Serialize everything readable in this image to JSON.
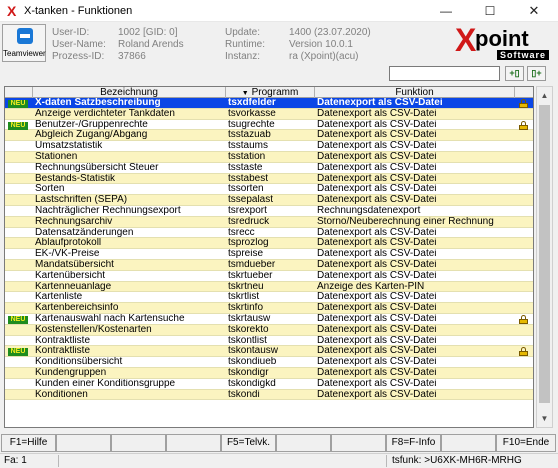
{
  "window": {
    "title": "X-tanken - Funktionen",
    "icon": "x-app-icon",
    "minimize": "—",
    "maximize": "☐",
    "close": "✕"
  },
  "teamviewer": {
    "label": "Teamviewer"
  },
  "info": {
    "labels1": "User-ID:\nUser-Name:\nProzess-ID:",
    "values1": "1002 [GID: 0]\nRoland Arends\n37866",
    "labels2": "Update:\nRuntime:\nInstanz:",
    "values2": "1400 (23.07.2020)\nVersion 10.0.1\nra (Xpoint)(acu)"
  },
  "logo": {
    "x": "X",
    "word": "point",
    "sub": "Software"
  },
  "toolbar": {
    "search_value": "",
    "btn1": "+▯",
    "btn2": "▯+"
  },
  "grid": {
    "headers": [
      "",
      "Bezeichnung",
      "Programm",
      "Funktion",
      ""
    ],
    "sort_indicator": "▼",
    "new_badge": "NEU",
    "rows": [
      {
        "new": true,
        "name": "X-daten Satzbeschreibung",
        "prog": "tsxdfelder",
        "func": "Datenexport als CSV-Datei",
        "lock": true,
        "selected": true
      },
      {
        "new": false,
        "name": "Anzeige verdichteter Tankdaten",
        "prog": "tsvorkasse",
        "func": "Datenexport als CSV-Datei",
        "lock": false
      },
      {
        "new": true,
        "name": "Benutzer-/Gruppenrechte",
        "prog": "tsugrechte",
        "func": "Datenexport als CSV-Datei",
        "lock": true
      },
      {
        "new": false,
        "name": "Abgleich Zugang/Abgang",
        "prog": "tsstazuab",
        "func": "Datenexport als CSV-Datei",
        "lock": false
      },
      {
        "new": false,
        "name": "Umsatzstatistik",
        "prog": "tsstaums",
        "func": "Datenexport als CSV-Datei",
        "lock": false
      },
      {
        "new": false,
        "name": "Stationen",
        "prog": "tsstation",
        "func": "Datenexport als CSV-Datei",
        "lock": false
      },
      {
        "new": false,
        "name": "Rechnungsübersicht Steuer",
        "prog": "tsstaste",
        "func": "Datenexport als CSV-Datei",
        "lock": false
      },
      {
        "new": false,
        "name": "Bestands-Statistik",
        "prog": "tsstabest",
        "func": "Datenexport als CSV-Datei",
        "lock": false
      },
      {
        "new": false,
        "name": "Sorten",
        "prog": "tssorten",
        "func": "Datenexport als CSV-Datei",
        "lock": false
      },
      {
        "new": false,
        "name": "Lastschriften (SEPA)",
        "prog": "tssepalast",
        "func": "Datenexport als CSV-Datei",
        "lock": false
      },
      {
        "new": false,
        "name": "Nachträglicher Rechnungsexport",
        "prog": "tsrexport",
        "func": "Rechnungsdatenexport",
        "lock": false
      },
      {
        "new": false,
        "name": "Rechnungsarchiv",
        "prog": "tsredruck",
        "func": "Storno/Neuberechnung einer Rechnung",
        "lock": false
      },
      {
        "new": false,
        "name": "Datensatzänderungen",
        "prog": "tsrecc",
        "func": "Datenexport als CSV-Datei",
        "lock": false
      },
      {
        "new": false,
        "name": "Ablaufprotokoll",
        "prog": "tsprozlog",
        "func": "Datenexport als CSV-Datei",
        "lock": false
      },
      {
        "new": false,
        "name": "EK-/VK-Preise",
        "prog": "tspreise",
        "func": "Datenexport als CSV-Datei",
        "lock": false
      },
      {
        "new": false,
        "name": "Mandatsübersicht",
        "prog": "tsmdueber",
        "func": "Datenexport als CSV-Datei",
        "lock": false
      },
      {
        "new": false,
        "name": "Kartenübersicht",
        "prog": "tskrtueber",
        "func": "Datenexport als CSV-Datei",
        "lock": false
      },
      {
        "new": false,
        "name": "Kartenneuanlage",
        "prog": "tskrtneu",
        "func": "Anzeige des Karten-PIN",
        "lock": false
      },
      {
        "new": false,
        "name": "Kartenliste",
        "prog": "tskrtlist",
        "func": "Datenexport als CSV-Datei",
        "lock": false
      },
      {
        "new": false,
        "name": "Kartenbereichsinfo",
        "prog": "tskrtinfo",
        "func": "Datenexport als CSV-Datei",
        "lock": false
      },
      {
        "new": true,
        "name": "Kartenauswahl nach Kartensuche",
        "prog": "tskrtausw",
        "func": "Datenexport als CSV-Datei",
        "lock": true
      },
      {
        "new": false,
        "name": "Kostenstellen/Kostenarten",
        "prog": "tskorekto",
        "func": "Datenexport als CSV-Datei",
        "lock": false
      },
      {
        "new": false,
        "name": "Kontraktliste",
        "prog": "tskontlist",
        "func": "Datenexport als CSV-Datei",
        "lock": false
      },
      {
        "new": true,
        "name": "Kontraktliste",
        "prog": "tskontausw",
        "func": "Datenexport als CSV-Datei",
        "lock": true
      },
      {
        "new": false,
        "name": "Konditionsübersicht",
        "prog": "tskondiueb",
        "func": "Datenexport als CSV-Datei",
        "lock": false
      },
      {
        "new": false,
        "name": "Kundengruppen",
        "prog": "tskondigr",
        "func": "Datenexport als CSV-Datei",
        "lock": false
      },
      {
        "new": false,
        "name": "Kunden einer Konditionsgruppe",
        "prog": "tskondigkd",
        "func": "Datenexport als CSV-Datei",
        "lock": false
      },
      {
        "new": false,
        "name": "Konditionen",
        "prog": "tskondi",
        "func": "Datenexport als CSV-Datei",
        "lock": false
      }
    ]
  },
  "scrollbar": {
    "up": "▲",
    "down": "▼"
  },
  "fkeys": [
    "F1=Hilfe",
    "",
    "",
    "",
    "F5=Telvk.",
    "",
    "",
    "F8=F-Info",
    "",
    "F10=Ende"
  ],
  "status": {
    "left": "Fa: 1",
    "right": "tsfunk: >U6XK-MH6R-MRHG"
  }
}
